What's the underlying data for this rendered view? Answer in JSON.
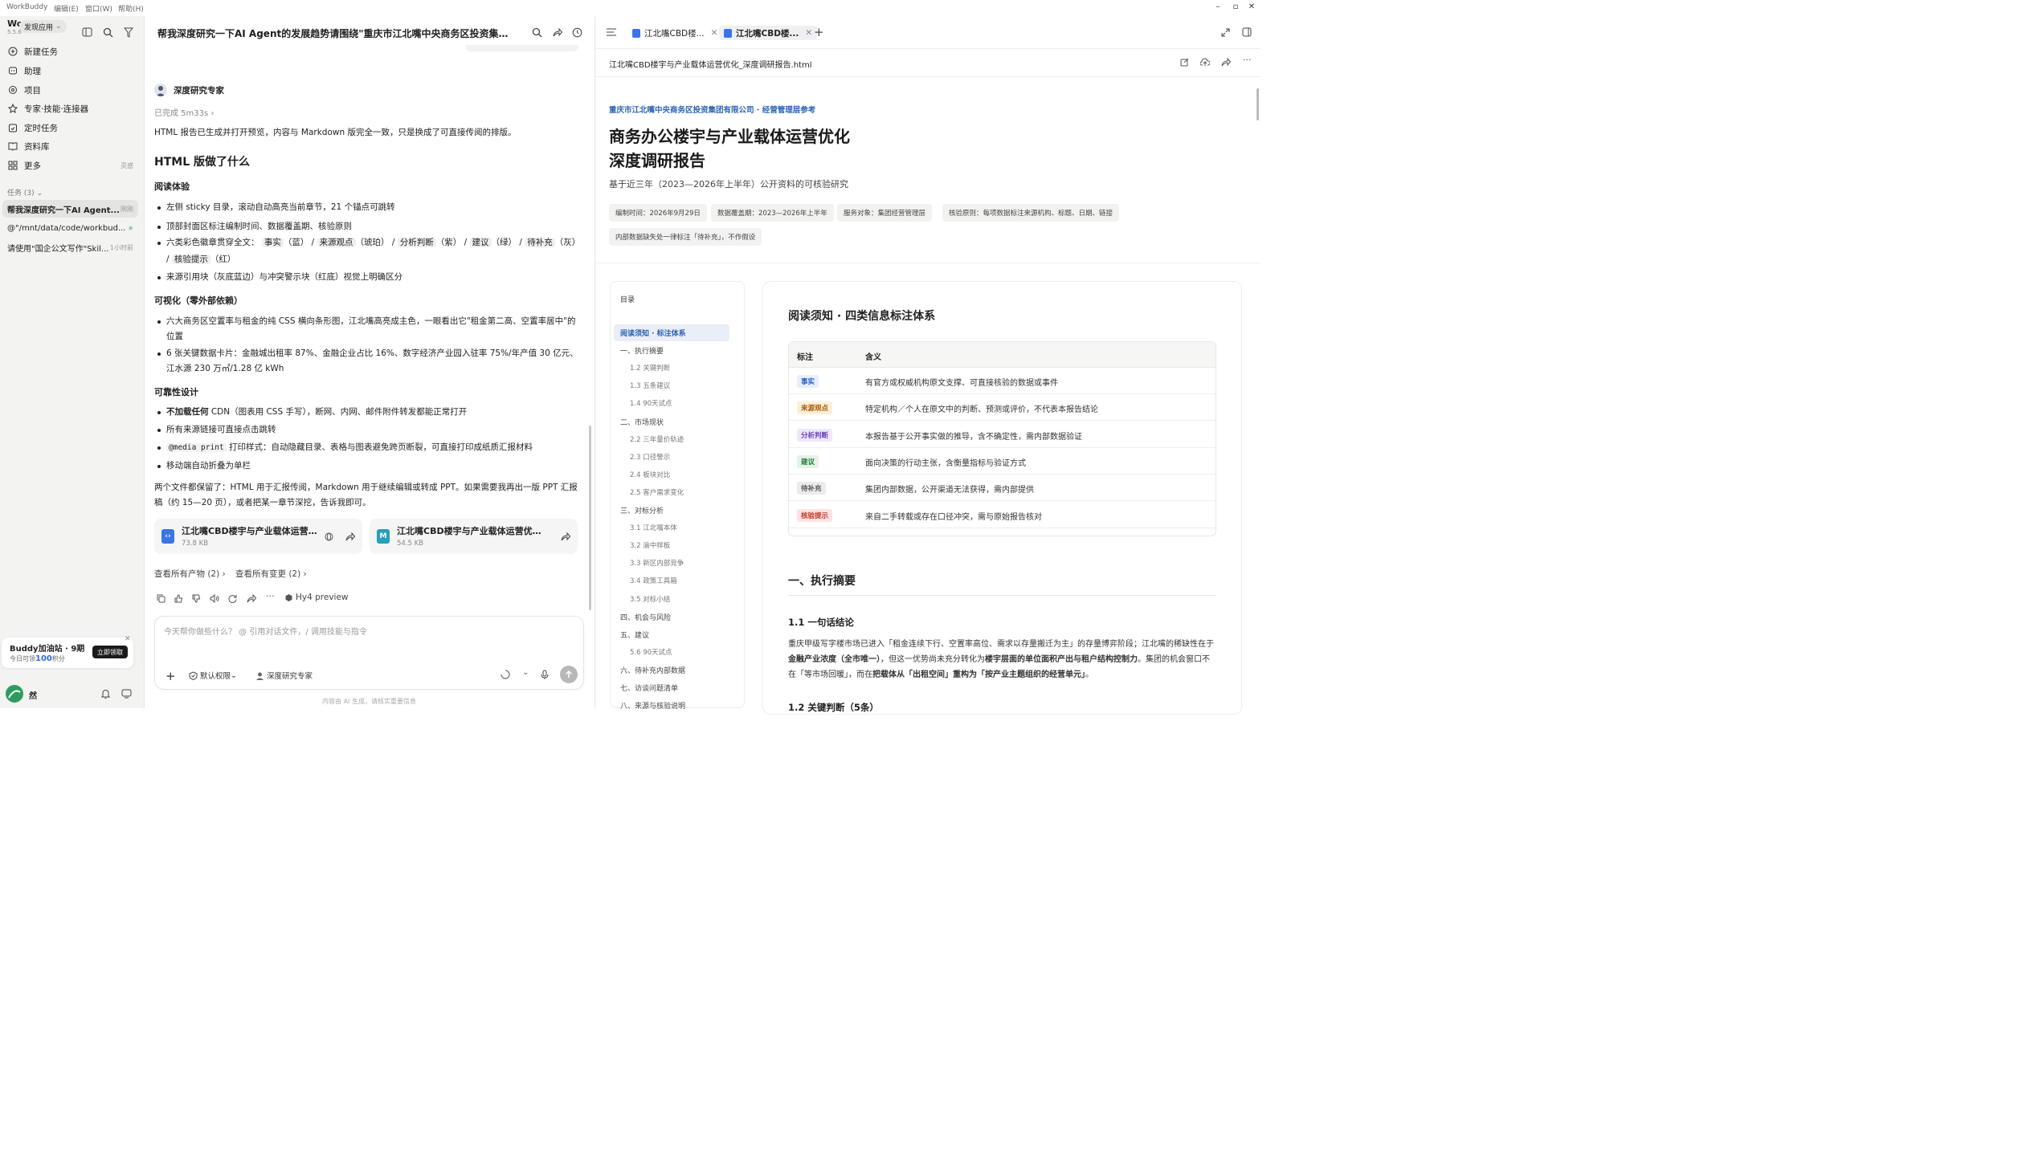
{
  "titlebar": {
    "app_name": "WorkBuddy",
    "menus": [
      "编辑(E)",
      "窗口(W)",
      "帮助(H)"
    ]
  },
  "sidebar": {
    "logo": "Wo",
    "version": "5.5.6",
    "discover_label": "发现应用",
    "nav": [
      {
        "label": "新建任务",
        "icon": "new-task-icon"
      },
      {
        "label": "助理",
        "icon": "assistant-icon"
      },
      {
        "label": "项目",
        "icon": "project-icon"
      },
      {
        "label": "专家·技能·连接器",
        "icon": "expert-icon"
      },
      {
        "label": "定时任务",
        "icon": "schedule-icon"
      },
      {
        "label": "资料库",
        "icon": "library-icon"
      },
      {
        "label": "更多",
        "icon": "more-icon",
        "meta": "灵感"
      }
    ],
    "tasks_header": "任务 (3)",
    "tasks": [
      {
        "title": "帮我深度研究一下AI Agent...",
        "meta": "刚刚"
      },
      {
        "title": "@\"/mnt/data/code/workbud...",
        "meta": ""
      },
      {
        "title": "请使用\"国企公文写作\"Skil...",
        "meta": "1小时前"
      }
    ],
    "promo": {
      "title": "Buddy加油站 · 9期",
      "sub_prefix": "今日可领",
      "points": "100",
      "sub_suffix": "积分",
      "button": "立即领取"
    },
    "user_name": "然"
  },
  "chat": {
    "title": "帮我深度研究一下AI Agent的发展趋势请围绕\"重庆市江北嘴中央商务区投资集团有限公...",
    "agent_name": "深度研究专家",
    "status": "已完成 5m33s",
    "intro": "HTML 报告已生成并打开预览，内容与 Markdown 版完全一致，只是换成了可直接传阅的排版。",
    "heading": "HTML 版做了什么",
    "sec1_title": "阅读体验",
    "sec1_items": [
      "左侧 sticky 目录，滚动自动高亮当前章节，21 个锚点可跳转",
      "顶部封面区标注编制时间、数据覆盖期、核验原则"
    ],
    "sec1_badge_line_a": "六类彩色徽章贯穿全文：",
    "sec1_badges": [
      {
        "b": "事实",
        "c": "（蓝）"
      },
      {
        "b": "来源观点",
        "c": "（琥珀）"
      },
      {
        "b": "分析判断",
        "c": "（紫）"
      },
      {
        "b": "建议",
        "c": "（绿）"
      },
      {
        "b": "待补充",
        "c": "（灰）"
      },
      {
        "b": "核验提示",
        "c": "（红）"
      }
    ],
    "sec1_last": "来源引用块（灰底蓝边）与冲突警示块（红底）视觉上明确区分",
    "sec2_title": "可视化（零外部依赖）",
    "sec2_items": [
      "六大商务区空置率与租金的纯 CSS 横向条形图，江北嘴高亮成主色，一眼看出它\"租金第二高、空置率居中\"的位置",
      "6 张关键数据卡片：金融城出租率 87%、金融企业占比 16%、数字经济产业园入驻率 75%/年产值 30 亿元、江水源 230 万㎡/1.28 亿 kWh"
    ],
    "sec3_title": "可靠性设计",
    "sec3_item1_bold": "不加载任何",
    "sec3_item1_rest": " CDN（图表用 CSS 手写），断网、内网、邮件附件转发都能正常打开",
    "sec3_item2": "所有来源链接可直接点击跳转",
    "sec3_item3_code": "@media print",
    "sec3_item3_rest": " 打印样式：自动隐藏目录、表格与图表避免跨页断裂，可直接打印成纸质汇报材料",
    "sec3_item4": "移动端自动折叠为单栏",
    "closing": "两个文件都保留了：HTML 用于汇报传阅，Markdown 用于继续编辑或转成 PPT。如果需要我再出一版 PPT 汇报稿（约 15—20 页），或者把某一章节深挖，告诉我即可。",
    "files": [
      {
        "name": "江北嘴CBD楼宇与产业载体运营优...",
        "size": "73.8 KB",
        "type": "HTML"
      },
      {
        "name": "江北嘴CBD楼宇与产业载体运营优化_...",
        "size": "54.5 KB",
        "type": "MD"
      }
    ],
    "view_artifacts": "查看所有产物 (2)",
    "view_changes": "查看所有变更 (2)",
    "model": "Hy4 preview",
    "input_placeholder": "今天帮你做些什么？ @ 引用对话文件，/ 调用技能与指令",
    "permission": "默认权限",
    "agent_chip": "深度研究专家",
    "disclaimer": "内容由 AI 生成，请核实重要信息"
  },
  "preview": {
    "tabs": [
      "江北嘴CBD楼...",
      "江北嘴CBD楼..."
    ],
    "filename": "江北嘴CBD楼宇与产业载体运营优化_深度调研报告.html",
    "org_line": "重庆市江北嘴中央商务区投资集团有限公司 · 经营管理层参考",
    "title_l1": "商务办公楼宇与产业载体运营优化",
    "title_l2": "深度调研报告",
    "subtitle": "基于近三年（2023—2026年上半年）公开资料的可核验研究",
    "chips": [
      "编制时间：2026年9月29日",
      "数据覆盖期：2023—2026年上半年",
      "服务对象：集团经营管理层",
      "核验原则：每项数据标注来源机构、标题、日期、链接",
      "内部数据缺失处一律标注「待补充」，不作假设"
    ],
    "toc_title": "目录",
    "toc": [
      {
        "label": "阅读须知 · 标注体系",
        "level": 1,
        "active": true
      },
      {
        "label": "一、执行摘要",
        "level": 1
      },
      {
        "label": "1.2 关键判断",
        "level": 2
      },
      {
        "label": "1.3 五条建议",
        "level": 2
      },
      {
        "label": "1.4 90天试点",
        "level": 2
      },
      {
        "label": "二、市场现状",
        "level": 1
      },
      {
        "label": "2.2 三年量价轨迹",
        "level": 2
      },
      {
        "label": "2.3 口径警示",
        "level": 2
      },
      {
        "label": "2.4 板块对比",
        "level": 2
      },
      {
        "label": "2.5 客户需求变化",
        "level": 2
      },
      {
        "label": "三、对标分析",
        "level": 1
      },
      {
        "label": "3.1 江北嘴本体",
        "level": 2
      },
      {
        "label": "3.2 渝中样板",
        "level": 2
      },
      {
        "label": "3.3 新区内部竞争",
        "level": 2
      },
      {
        "label": "3.4 政策工具箱",
        "level": 2
      },
      {
        "label": "3.5 对标小结",
        "level": 2
      },
      {
        "label": "四、机会与风险",
        "level": 1
      },
      {
        "label": "五、建议",
        "level": 1
      },
      {
        "label": "5.6 90天试点",
        "level": 2
      },
      {
        "label": "六、待补充内部数据",
        "level": 1
      },
      {
        "label": "七、访谈问题清单",
        "level": 1
      },
      {
        "label": "八、来源与核验说明",
        "level": 1
      }
    ],
    "section_title": "阅读须知 · 四类信息标注体系",
    "legend_headers": [
      "标注",
      "含义"
    ],
    "legend": [
      {
        "tag": "事实",
        "desc": "有官方或权威机构原文支撑、可直接核验的数据或事件",
        "color": "#1f5fbf",
        "bg": "#e6effc"
      },
      {
        "tag": "来源观点",
        "desc": "特定机构／个人在原文中的判断、预测或评价，不代表本报告结论",
        "color": "#a85a00",
        "bg": "#fcefd9"
      },
      {
        "tag": "分析判断",
        "desc": "本报告基于公开事实做的推导，含不确定性，需内部数据验证",
        "color": "#6b3fb8",
        "bg": "#efe7fb"
      },
      {
        "tag": "建议",
        "desc": "面向决策的行动主张，含衡量指标与验证方式",
        "color": "#237a3a",
        "bg": "#e3f4e6"
      },
      {
        "tag": "待补充",
        "desc": "集团内部数据，公开渠道无法获得，需内部提供",
        "color": "#555555",
        "bg": "#ececec"
      },
      {
        "tag": "核验提示",
        "desc": "来自二手转载或存在口径冲突，需与原始报告核对",
        "color": "#c0392b",
        "bg": "#fbe4e2"
      }
    ],
    "exec_title": "一、执行摘要",
    "exec_sub": "1.1 一句话结论",
    "exec_p_a": "重庆甲级写字楼市场已进入「租金连续下行、空置率高位、需求以存量搬迁为主」的存量博弈阶段；江北嘴的稀缺性在于",
    "exec_p_b1": "金融产业浓度（全市唯一）",
    "exec_p_c": "，但这一优势尚未充分转化为",
    "exec_p_b2": "楼宇层面的单位面积产出与租户结构控制力",
    "exec_p_d": "。集团的机会窗口不在「等市场回暖」，而在",
    "exec_p_b3": "把载体从「出租空间」重构为「按产业主题组织的经营单元」",
    "exec_p_e": "。",
    "exec_sub2": "1.2 关键判断（5条）"
  }
}
